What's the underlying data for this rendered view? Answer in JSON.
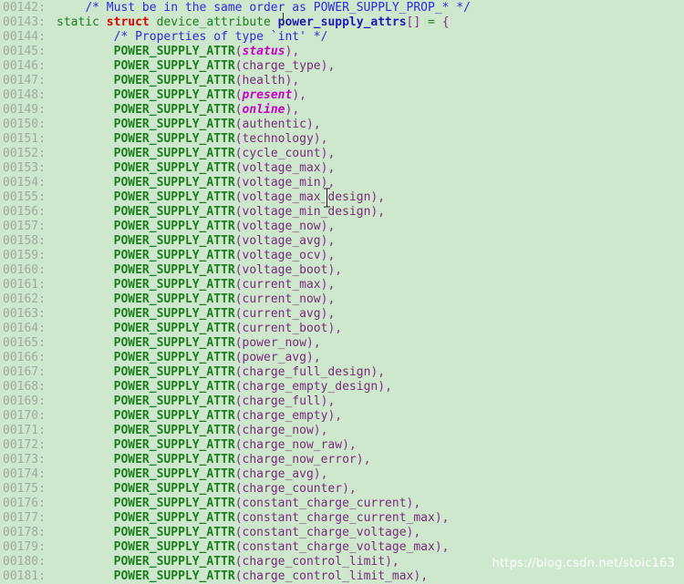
{
  "editor": {
    "background_color": "#cde8cd",
    "lineno_color": "#a0a8a0",
    "colors": {
      "comment": "#2a2ae0",
      "keyword_green": "#1d7d1d",
      "keyword_red": "#e00000",
      "macro_green": "#1d7d1d",
      "identifier_blue": "#1a1ab8",
      "punctuation_purple": "#8b2a8b",
      "argument_purple": "#7a2a7a",
      "argument_highlight": "#c800c8"
    },
    "first_line_number": "00142",
    "last_line_number": "00181",
    "cursor": {
      "text_caret_line": "00143",
      "text_caret_before_token": "power_supply_attrs",
      "mouse_pointer_shape": "i-beam",
      "mouse_pointer_near_line": "00155"
    }
  },
  "watermark": {
    "text": "https://blog.csdn.net/stoic163"
  },
  "lines": [
    {
      "no": "00142",
      "tokens": [
        {
          "t": "    ",
          "c": "t-plain"
        },
        {
          "t": "/* Must be in the same order as POWER_SUPPLY_PROP_* */",
          "c": "t-comment"
        }
      ]
    },
    {
      "no": "00143",
      "tokens": [
        {
          "t": "static ",
          "c": "t-keyword"
        },
        {
          "t": "struct",
          "c": "t-kw-red"
        },
        {
          "t": " device_attribute ",
          "c": "t-type"
        },
        {
          "t": "power_supply_attrs",
          "c": "t-var-blue"
        },
        {
          "t": "[]",
          "c": "t-punct"
        },
        {
          "t": " = ",
          "c": "t-op"
        },
        {
          "t": "{",
          "c": "t-punct"
        }
      ]
    },
    {
      "no": "00144",
      "tokens": [
        {
          "t": "        ",
          "c": "t-plain"
        },
        {
          "t": "/* Properties of type `int' */",
          "c": "t-comment"
        }
      ]
    },
    {
      "no": "00145",
      "tokens": [
        {
          "t": "        ",
          "c": "t-plain"
        },
        {
          "t": "POWER_SUPPLY_ATTR",
          "c": "t-fn"
        },
        {
          "t": "(",
          "c": "t-punct"
        },
        {
          "t": "status",
          "c": "t-arg-em"
        },
        {
          "t": ")",
          "c": "t-punct"
        },
        {
          "t": ",",
          "c": "t-punct"
        }
      ]
    },
    {
      "no": "00146",
      "tokens": [
        {
          "t": "        ",
          "c": "t-plain"
        },
        {
          "t": "POWER_SUPPLY_ATTR",
          "c": "t-fn"
        },
        {
          "t": "(",
          "c": "t-punct"
        },
        {
          "t": "charge_type",
          "c": "t-arg"
        },
        {
          "t": ")",
          "c": "t-punct"
        },
        {
          "t": ",",
          "c": "t-punct"
        }
      ]
    },
    {
      "no": "00147",
      "tokens": [
        {
          "t": "        ",
          "c": "t-plain"
        },
        {
          "t": "POWER_SUPPLY_ATTR",
          "c": "t-fn"
        },
        {
          "t": "(",
          "c": "t-punct"
        },
        {
          "t": "health",
          "c": "t-arg"
        },
        {
          "t": ")",
          "c": "t-punct"
        },
        {
          "t": ",",
          "c": "t-punct"
        }
      ]
    },
    {
      "no": "00148",
      "tokens": [
        {
          "t": "        ",
          "c": "t-plain"
        },
        {
          "t": "POWER_SUPPLY_ATTR",
          "c": "t-fn"
        },
        {
          "t": "(",
          "c": "t-punct"
        },
        {
          "t": "present",
          "c": "t-arg-em"
        },
        {
          "t": ")",
          "c": "t-punct"
        },
        {
          "t": ",",
          "c": "t-punct"
        }
      ]
    },
    {
      "no": "00149",
      "tokens": [
        {
          "t": "        ",
          "c": "t-plain"
        },
        {
          "t": "POWER_SUPPLY_ATTR",
          "c": "t-fn"
        },
        {
          "t": "(",
          "c": "t-punct"
        },
        {
          "t": "online",
          "c": "t-arg-em"
        },
        {
          "t": ")",
          "c": "t-punct"
        },
        {
          "t": ",",
          "c": "t-punct"
        }
      ]
    },
    {
      "no": "00150",
      "tokens": [
        {
          "t": "        ",
          "c": "t-plain"
        },
        {
          "t": "POWER_SUPPLY_ATTR",
          "c": "t-fn"
        },
        {
          "t": "(",
          "c": "t-punct"
        },
        {
          "t": "authentic",
          "c": "t-arg"
        },
        {
          "t": ")",
          "c": "t-punct"
        },
        {
          "t": ",",
          "c": "t-punct"
        }
      ]
    },
    {
      "no": "00151",
      "tokens": [
        {
          "t": "        ",
          "c": "t-plain"
        },
        {
          "t": "POWER_SUPPLY_ATTR",
          "c": "t-fn"
        },
        {
          "t": "(",
          "c": "t-punct"
        },
        {
          "t": "technology",
          "c": "t-arg"
        },
        {
          "t": ")",
          "c": "t-punct"
        },
        {
          "t": ",",
          "c": "t-punct"
        }
      ]
    },
    {
      "no": "00152",
      "tokens": [
        {
          "t": "        ",
          "c": "t-plain"
        },
        {
          "t": "POWER_SUPPLY_ATTR",
          "c": "t-fn"
        },
        {
          "t": "(",
          "c": "t-punct"
        },
        {
          "t": "cycle_count",
          "c": "t-arg"
        },
        {
          "t": ")",
          "c": "t-punct"
        },
        {
          "t": ",",
          "c": "t-punct"
        }
      ]
    },
    {
      "no": "00153",
      "tokens": [
        {
          "t": "        ",
          "c": "t-plain"
        },
        {
          "t": "POWER_SUPPLY_ATTR",
          "c": "t-fn"
        },
        {
          "t": "(",
          "c": "t-punct"
        },
        {
          "t": "voltage_max",
          "c": "t-arg"
        },
        {
          "t": ")",
          "c": "t-punct"
        },
        {
          "t": ",",
          "c": "t-punct"
        }
      ]
    },
    {
      "no": "00154",
      "tokens": [
        {
          "t": "        ",
          "c": "t-plain"
        },
        {
          "t": "POWER_SUPPLY_ATTR",
          "c": "t-fn"
        },
        {
          "t": "(",
          "c": "t-punct"
        },
        {
          "t": "voltage_min",
          "c": "t-arg"
        },
        {
          "t": ")",
          "c": "t-punct"
        },
        {
          "t": ",",
          "c": "t-punct"
        }
      ]
    },
    {
      "no": "00155",
      "tokens": [
        {
          "t": "        ",
          "c": "t-plain"
        },
        {
          "t": "POWER_SUPPLY_ATTR",
          "c": "t-fn"
        },
        {
          "t": "(",
          "c": "t-punct"
        },
        {
          "t": "voltage_max_design",
          "c": "t-arg"
        },
        {
          "t": ")",
          "c": "t-punct"
        },
        {
          "t": ",",
          "c": "t-punct"
        }
      ]
    },
    {
      "no": "00156",
      "tokens": [
        {
          "t": "        ",
          "c": "t-plain"
        },
        {
          "t": "POWER_SUPPLY_ATTR",
          "c": "t-fn"
        },
        {
          "t": "(",
          "c": "t-punct"
        },
        {
          "t": "voltage_min_design",
          "c": "t-arg"
        },
        {
          "t": ")",
          "c": "t-punct"
        },
        {
          "t": ",",
          "c": "t-punct"
        }
      ]
    },
    {
      "no": "00157",
      "tokens": [
        {
          "t": "        ",
          "c": "t-plain"
        },
        {
          "t": "POWER_SUPPLY_ATTR",
          "c": "t-fn"
        },
        {
          "t": "(",
          "c": "t-punct"
        },
        {
          "t": "voltage_now",
          "c": "t-arg"
        },
        {
          "t": ")",
          "c": "t-punct"
        },
        {
          "t": ",",
          "c": "t-punct"
        }
      ]
    },
    {
      "no": "00158",
      "tokens": [
        {
          "t": "        ",
          "c": "t-plain"
        },
        {
          "t": "POWER_SUPPLY_ATTR",
          "c": "t-fn"
        },
        {
          "t": "(",
          "c": "t-punct"
        },
        {
          "t": "voltage_avg",
          "c": "t-arg"
        },
        {
          "t": ")",
          "c": "t-punct"
        },
        {
          "t": ",",
          "c": "t-punct"
        }
      ]
    },
    {
      "no": "00159",
      "tokens": [
        {
          "t": "        ",
          "c": "t-plain"
        },
        {
          "t": "POWER_SUPPLY_ATTR",
          "c": "t-fn"
        },
        {
          "t": "(",
          "c": "t-punct"
        },
        {
          "t": "voltage_ocv",
          "c": "t-arg"
        },
        {
          "t": ")",
          "c": "t-punct"
        },
        {
          "t": ",",
          "c": "t-punct"
        }
      ]
    },
    {
      "no": "00160",
      "tokens": [
        {
          "t": "        ",
          "c": "t-plain"
        },
        {
          "t": "POWER_SUPPLY_ATTR",
          "c": "t-fn"
        },
        {
          "t": "(",
          "c": "t-punct"
        },
        {
          "t": "voltage_boot",
          "c": "t-arg"
        },
        {
          "t": ")",
          "c": "t-punct"
        },
        {
          "t": ",",
          "c": "t-punct"
        }
      ]
    },
    {
      "no": "00161",
      "tokens": [
        {
          "t": "        ",
          "c": "t-plain"
        },
        {
          "t": "POWER_SUPPLY_ATTR",
          "c": "t-fn"
        },
        {
          "t": "(",
          "c": "t-punct"
        },
        {
          "t": "current_max",
          "c": "t-arg"
        },
        {
          "t": ")",
          "c": "t-punct"
        },
        {
          "t": ",",
          "c": "t-punct"
        }
      ]
    },
    {
      "no": "00162",
      "tokens": [
        {
          "t": "        ",
          "c": "t-plain"
        },
        {
          "t": "POWER_SUPPLY_ATTR",
          "c": "t-fn"
        },
        {
          "t": "(",
          "c": "t-punct"
        },
        {
          "t": "current_now",
          "c": "t-arg"
        },
        {
          "t": ")",
          "c": "t-punct"
        },
        {
          "t": ",",
          "c": "t-punct"
        }
      ]
    },
    {
      "no": "00163",
      "tokens": [
        {
          "t": "        ",
          "c": "t-plain"
        },
        {
          "t": "POWER_SUPPLY_ATTR",
          "c": "t-fn"
        },
        {
          "t": "(",
          "c": "t-punct"
        },
        {
          "t": "current_avg",
          "c": "t-arg"
        },
        {
          "t": ")",
          "c": "t-punct"
        },
        {
          "t": ",",
          "c": "t-punct"
        }
      ]
    },
    {
      "no": "00164",
      "tokens": [
        {
          "t": "        ",
          "c": "t-plain"
        },
        {
          "t": "POWER_SUPPLY_ATTR",
          "c": "t-fn"
        },
        {
          "t": "(",
          "c": "t-punct"
        },
        {
          "t": "current_boot",
          "c": "t-arg"
        },
        {
          "t": ")",
          "c": "t-punct"
        },
        {
          "t": ",",
          "c": "t-punct"
        }
      ]
    },
    {
      "no": "00165",
      "tokens": [
        {
          "t": "        ",
          "c": "t-plain"
        },
        {
          "t": "POWER_SUPPLY_ATTR",
          "c": "t-fn"
        },
        {
          "t": "(",
          "c": "t-punct"
        },
        {
          "t": "power_now",
          "c": "t-arg"
        },
        {
          "t": ")",
          "c": "t-punct"
        },
        {
          "t": ",",
          "c": "t-punct"
        }
      ]
    },
    {
      "no": "00166",
      "tokens": [
        {
          "t": "        ",
          "c": "t-plain"
        },
        {
          "t": "POWER_SUPPLY_ATTR",
          "c": "t-fn"
        },
        {
          "t": "(",
          "c": "t-punct"
        },
        {
          "t": "power_avg",
          "c": "t-arg"
        },
        {
          "t": ")",
          "c": "t-punct"
        },
        {
          "t": ",",
          "c": "t-punct"
        }
      ]
    },
    {
      "no": "00167",
      "tokens": [
        {
          "t": "        ",
          "c": "t-plain"
        },
        {
          "t": "POWER_SUPPLY_ATTR",
          "c": "t-fn"
        },
        {
          "t": "(",
          "c": "t-punct"
        },
        {
          "t": "charge_full_design",
          "c": "t-arg"
        },
        {
          "t": ")",
          "c": "t-punct"
        },
        {
          "t": ",",
          "c": "t-punct"
        }
      ]
    },
    {
      "no": "00168",
      "tokens": [
        {
          "t": "        ",
          "c": "t-plain"
        },
        {
          "t": "POWER_SUPPLY_ATTR",
          "c": "t-fn"
        },
        {
          "t": "(",
          "c": "t-punct"
        },
        {
          "t": "charge_empty_design",
          "c": "t-arg"
        },
        {
          "t": ")",
          "c": "t-punct"
        },
        {
          "t": ",",
          "c": "t-punct"
        }
      ]
    },
    {
      "no": "00169",
      "tokens": [
        {
          "t": "        ",
          "c": "t-plain"
        },
        {
          "t": "POWER_SUPPLY_ATTR",
          "c": "t-fn"
        },
        {
          "t": "(",
          "c": "t-punct"
        },
        {
          "t": "charge_full",
          "c": "t-arg"
        },
        {
          "t": ")",
          "c": "t-punct"
        },
        {
          "t": ",",
          "c": "t-punct"
        }
      ]
    },
    {
      "no": "00170",
      "tokens": [
        {
          "t": "        ",
          "c": "t-plain"
        },
        {
          "t": "POWER_SUPPLY_ATTR",
          "c": "t-fn"
        },
        {
          "t": "(",
          "c": "t-punct"
        },
        {
          "t": "charge_empty",
          "c": "t-arg"
        },
        {
          "t": ")",
          "c": "t-punct"
        },
        {
          "t": ",",
          "c": "t-punct"
        }
      ]
    },
    {
      "no": "00171",
      "tokens": [
        {
          "t": "        ",
          "c": "t-plain"
        },
        {
          "t": "POWER_SUPPLY_ATTR",
          "c": "t-fn"
        },
        {
          "t": "(",
          "c": "t-punct"
        },
        {
          "t": "charge_now",
          "c": "t-arg"
        },
        {
          "t": ")",
          "c": "t-punct"
        },
        {
          "t": ",",
          "c": "t-punct"
        }
      ]
    },
    {
      "no": "00172",
      "tokens": [
        {
          "t": "        ",
          "c": "t-plain"
        },
        {
          "t": "POWER_SUPPLY_ATTR",
          "c": "t-fn"
        },
        {
          "t": "(",
          "c": "t-punct"
        },
        {
          "t": "charge_now_raw",
          "c": "t-arg"
        },
        {
          "t": ")",
          "c": "t-punct"
        },
        {
          "t": ",",
          "c": "t-punct"
        }
      ]
    },
    {
      "no": "00173",
      "tokens": [
        {
          "t": "        ",
          "c": "t-plain"
        },
        {
          "t": "POWER_SUPPLY_ATTR",
          "c": "t-fn"
        },
        {
          "t": "(",
          "c": "t-punct"
        },
        {
          "t": "charge_now_error",
          "c": "t-arg"
        },
        {
          "t": ")",
          "c": "t-punct"
        },
        {
          "t": ",",
          "c": "t-punct"
        }
      ]
    },
    {
      "no": "00174",
      "tokens": [
        {
          "t": "        ",
          "c": "t-plain"
        },
        {
          "t": "POWER_SUPPLY_ATTR",
          "c": "t-fn"
        },
        {
          "t": "(",
          "c": "t-punct"
        },
        {
          "t": "charge_avg",
          "c": "t-arg"
        },
        {
          "t": ")",
          "c": "t-punct"
        },
        {
          "t": ",",
          "c": "t-punct"
        }
      ]
    },
    {
      "no": "00175",
      "tokens": [
        {
          "t": "        ",
          "c": "t-plain"
        },
        {
          "t": "POWER_SUPPLY_ATTR",
          "c": "t-fn"
        },
        {
          "t": "(",
          "c": "t-punct"
        },
        {
          "t": "charge_counter",
          "c": "t-arg"
        },
        {
          "t": ")",
          "c": "t-punct"
        },
        {
          "t": ",",
          "c": "t-punct"
        }
      ]
    },
    {
      "no": "00176",
      "tokens": [
        {
          "t": "        ",
          "c": "t-plain"
        },
        {
          "t": "POWER_SUPPLY_ATTR",
          "c": "t-fn"
        },
        {
          "t": "(",
          "c": "t-punct"
        },
        {
          "t": "constant_charge_current",
          "c": "t-arg"
        },
        {
          "t": ")",
          "c": "t-punct"
        },
        {
          "t": ",",
          "c": "t-punct"
        }
      ]
    },
    {
      "no": "00177",
      "tokens": [
        {
          "t": "        ",
          "c": "t-plain"
        },
        {
          "t": "POWER_SUPPLY_ATTR",
          "c": "t-fn"
        },
        {
          "t": "(",
          "c": "t-punct"
        },
        {
          "t": "constant_charge_current_max",
          "c": "t-arg"
        },
        {
          "t": ")",
          "c": "t-punct"
        },
        {
          "t": ",",
          "c": "t-punct"
        }
      ]
    },
    {
      "no": "00178",
      "tokens": [
        {
          "t": "        ",
          "c": "t-plain"
        },
        {
          "t": "POWER_SUPPLY_ATTR",
          "c": "t-fn"
        },
        {
          "t": "(",
          "c": "t-punct"
        },
        {
          "t": "constant_charge_voltage",
          "c": "t-arg"
        },
        {
          "t": ")",
          "c": "t-punct"
        },
        {
          "t": ",",
          "c": "t-punct"
        }
      ]
    },
    {
      "no": "00179",
      "tokens": [
        {
          "t": "        ",
          "c": "t-plain"
        },
        {
          "t": "POWER_SUPPLY_ATTR",
          "c": "t-fn"
        },
        {
          "t": "(",
          "c": "t-punct"
        },
        {
          "t": "constant_charge_voltage_max",
          "c": "t-arg"
        },
        {
          "t": ")",
          "c": "t-punct"
        },
        {
          "t": ",",
          "c": "t-punct"
        }
      ]
    },
    {
      "no": "00180",
      "tokens": [
        {
          "t": "        ",
          "c": "t-plain"
        },
        {
          "t": "POWER_SUPPLY_ATTR",
          "c": "t-fn"
        },
        {
          "t": "(",
          "c": "t-punct"
        },
        {
          "t": "charge_control_limit",
          "c": "t-arg"
        },
        {
          "t": ")",
          "c": "t-punct"
        },
        {
          "t": ",",
          "c": "t-punct"
        }
      ]
    },
    {
      "no": "00181",
      "tokens": [
        {
          "t": "        ",
          "c": "t-plain"
        },
        {
          "t": "POWER_SUPPLY_ATTR",
          "c": "t-fn"
        },
        {
          "t": "(",
          "c": "t-punct"
        },
        {
          "t": "charge_control_limit_max",
          "c": "t-arg"
        },
        {
          "t": ")",
          "c": "t-punct"
        },
        {
          "t": ",",
          "c": "t-punct"
        }
      ]
    }
  ]
}
